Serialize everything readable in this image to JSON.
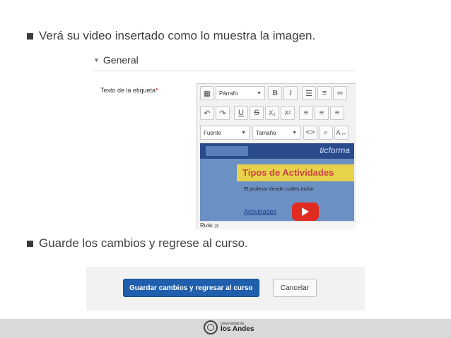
{
  "bullets": {
    "first": "Verá su video insertado como lo muestra la imagen.",
    "second": "Guarde los cambios y regrese al curso."
  },
  "editor_shot": {
    "section_title": "General",
    "field_label": "Texto de la etiqueta",
    "required_mark": "*",
    "toolbar": {
      "paragraph_select": "Párrafo",
      "bold": "B",
      "italic": "I",
      "underline": "U",
      "strikethrough": "S",
      "subscript": "X₂",
      "superscript": "X²",
      "font_select": "Fuente",
      "size_select": "Tamaño",
      "source_code": "<>"
    },
    "status_path": "Ruta: p"
  },
  "save_shot": {
    "save_button": "Guardar cambios y regresar al curso",
    "cancel_button": "Cancelar"
  },
  "footer": {
    "university_small": "Universidad de",
    "university_name": "los Andes"
  },
  "colors": {
    "primary_button": "#1f5fad",
    "required": "#cc0000",
    "footer_bg": "#d9d9d9"
  }
}
